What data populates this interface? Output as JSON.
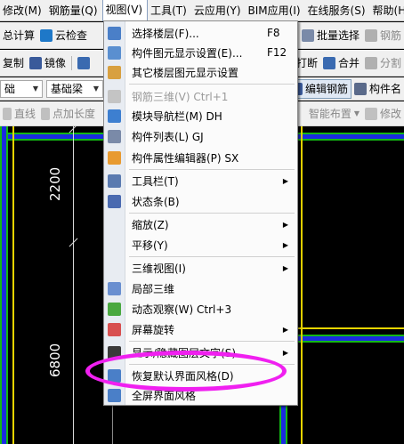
{
  "menubar": [
    "修改(M)",
    "钢筋量(Q)",
    "视图(V)",
    "工具(T)",
    "云应用(Y)",
    "BIM应用(I)",
    "在线服务(S)",
    "帮助(H"
  ],
  "toolbar1": {
    "left": [
      "总计算",
      "云检查"
    ],
    "right": [
      "批量选择",
      "钢筋"
    ]
  },
  "toolbar2": {
    "left": [
      "复制",
      "镜像"
    ],
    "right": [
      "打断",
      "合并",
      "分割"
    ]
  },
  "toolbar3": {
    "combo1": "础",
    "combo2": "基础梁",
    "right": [
      "编辑钢筋",
      "构件名"
    ]
  },
  "toolbar4": {
    "left": [
      "直线",
      "点加长度"
    ],
    "right": [
      "智能布置",
      "修改"
    ]
  },
  "canvas": {
    "dim_top": "2200",
    "dim_bottom": "6800"
  },
  "view_menu": {
    "items": [
      {
        "label": "选择楼层(F)...",
        "shortcut": "F8",
        "icon": "floor-select-icon",
        "color": "#4a7fc8"
      },
      {
        "label": "构件图元显示设置(E)...",
        "shortcut": "F12",
        "icon": "display-settings-icon",
        "color": "#5a8fd0"
      },
      {
        "label": "其它楼层图元显示设置",
        "shortcut": "",
        "icon": "other-floor-display-icon",
        "color": "#d8a040"
      },
      {
        "label": "钢筋三维(V)   Ctrl+1",
        "shortcut": "",
        "icon": "rebar-3d-icon",
        "color": "#b8b8b8",
        "disabled": true
      },
      {
        "label": "模块导航栏(M)   DH",
        "shortcut": "",
        "icon": "module-nav-icon",
        "color": "#3d7fd0"
      },
      {
        "label": "构件列表(L)   GJ",
        "shortcut": "",
        "icon": "component-list-icon",
        "color": "#7a8aa8"
      },
      {
        "label": "构件属性编辑器(P)   SX",
        "shortcut": "",
        "icon": "property-editor-icon",
        "color": "#e89a30"
      },
      {
        "label": "工具栏(T)",
        "shortcut": "",
        "icon": "toolbar-icon",
        "color": "#5a7ab0",
        "submenu": true
      },
      {
        "label": "状态条(B)",
        "shortcut": "",
        "icon": "statusbar-icon",
        "color": "#4a6ab0"
      },
      {
        "label": "缩放(Z)",
        "shortcut": "",
        "icon": "",
        "submenu": true
      },
      {
        "label": "平移(Y)",
        "shortcut": "",
        "icon": "",
        "submenu": true
      },
      {
        "label": "三维视图(I)",
        "shortcut": "",
        "icon": "",
        "submenu": true
      },
      {
        "label": "局部三维",
        "shortcut": "",
        "icon": "local-3d-icon",
        "color": "#6a8fd0"
      },
      {
        "label": "动态观察(W)   Ctrl+3",
        "shortcut": "",
        "icon": "dynamic-orbit-icon",
        "color": "#4aa840"
      },
      {
        "label": "屏幕旋转",
        "shortcut": "",
        "icon": "screen-rotate-icon",
        "color": "#d85050",
        "submenu": true
      },
      {
        "label": "显示/隐藏图层文字(S)",
        "shortcut": "",
        "icon": "layer-text-icon",
        "color": "#3a3a3a",
        "submenu": true
      },
      {
        "label": "恢复默认界面风格(D)",
        "shortcut": "",
        "icon": "restore-default-icon",
        "color": "#4a7fc8"
      },
      {
        "label": "全屏界面风格",
        "shortcut": "",
        "icon": "fullscreen-icon",
        "color": "#4a7fc8"
      }
    ]
  }
}
